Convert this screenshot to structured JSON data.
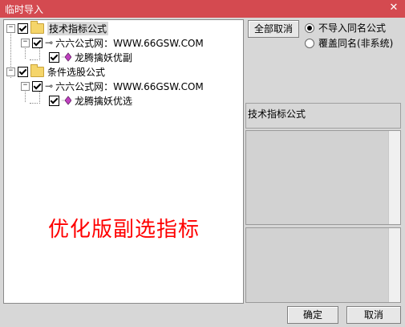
{
  "window": {
    "title": "临时导入",
    "close_glyph": "✕"
  },
  "tree": {
    "nodes": [
      {
        "label": "技术指标公式",
        "selected": true
      },
      {
        "label": "六六公式网：WWW.66GSW.COM"
      },
      {
        "label": "龙腾擒妖优副"
      },
      {
        "label": "条件选股公式"
      },
      {
        "label": "六六公式网：WWW.66GSW.COM"
      },
      {
        "label": "龙腾擒妖优选"
      }
    ],
    "expander_glyph": "−"
  },
  "overlay_text": "优化版副选指标",
  "options": {
    "cancel_all_label": "全部取消",
    "radio_skip": "不导入同名公式",
    "radio_overwrite": "覆盖同名(非系统)",
    "selected": "skip"
  },
  "info": {
    "type_label": "技术指标公式"
  },
  "footer": {
    "ok_label": "确定",
    "cancel_label": "取消"
  },
  "icons": {
    "folder": "folder-icon",
    "key": "key-icon",
    "formula": "formula-gem-icon"
  }
}
